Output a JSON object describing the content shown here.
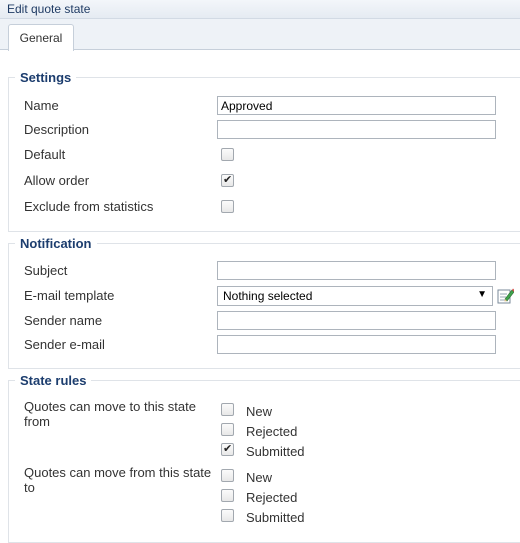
{
  "dialog": {
    "title": "Edit quote state"
  },
  "tabs": [
    {
      "label": "General"
    }
  ],
  "settings": {
    "legend": "Settings",
    "name_label": "Name",
    "name_value": "Approved",
    "description_label": "Description",
    "description_value": "",
    "default_label": "Default",
    "default_checked": false,
    "allow_order_label": "Allow order",
    "allow_order_checked": true,
    "exclude_label": "Exclude from statistics",
    "exclude_checked": false
  },
  "notification": {
    "legend": "Notification",
    "subject_label": "Subject",
    "subject_value": "",
    "template_label": "E-mail template",
    "template_value": "Nothing selected",
    "sender_name_label": "Sender name",
    "sender_name_value": "",
    "sender_email_label": "Sender e-mail",
    "sender_email_value": "",
    "edit_icon": "pencil-edit-icon"
  },
  "state_rules": {
    "legend": "State rules",
    "move_to_label": "Quotes can move to this state from",
    "move_to_options": [
      {
        "label": "New",
        "checked": false
      },
      {
        "label": "Rejected",
        "checked": false
      },
      {
        "label": "Submitted",
        "checked": true
      }
    ],
    "move_from_label": "Quotes can move from this state to",
    "move_from_options": [
      {
        "label": "New",
        "checked": false
      },
      {
        "label": "Rejected",
        "checked": false
      },
      {
        "label": "Submitted",
        "checked": false
      }
    ]
  },
  "colors": {
    "legend": "#1c3d6e",
    "border": "#dfe3e8",
    "tab_strip": "#eef2f7"
  }
}
